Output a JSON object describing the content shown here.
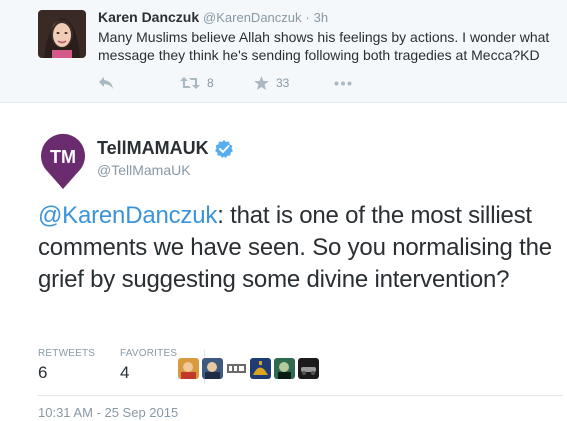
{
  "top_tweet": {
    "name": "Karen Danczuk",
    "handle": "@KarenDanczuk",
    "separator": "·",
    "time": "3h",
    "text": "Many Muslims believe Allah shows his feelings by actions. I wonder what message they think he's sending following both tragedies at Mecca?KD",
    "actions": {
      "reply_icon": "reply-icon",
      "retweet_icon": "retweet-icon",
      "retweet_count": "8",
      "favorite_icon": "star-icon",
      "favorite_count": "33",
      "more_icon": "more-icon"
    }
  },
  "main_tweet": {
    "avatar_initials": "TM",
    "name": "TellMAMAUK",
    "verified_icon": "verified-badge-icon",
    "handle": "@TellMamaUK",
    "mention": "@KarenDanczuk",
    "text_rest": ": that is one of the most silliest comments we have seen. So you normalising the grief by suggesting some divine intervention?",
    "stats": {
      "retweets_label": "RETWEETS",
      "retweets_value": "6",
      "favorites_label": "FAVORITES",
      "favorites_value": "4"
    },
    "favoriter_avatars": [
      "avatar-1",
      "avatar-2",
      "avatar-news",
      "avatar-4",
      "avatar-5",
      "avatar-6"
    ],
    "timestamp": "10:31 AM - 25 Sep 2015"
  },
  "colors": {
    "accent": "#3b94d9",
    "brand_purple": "#6a2c6f",
    "muted": "#8899a6",
    "background_top": "#f5f8fa"
  }
}
